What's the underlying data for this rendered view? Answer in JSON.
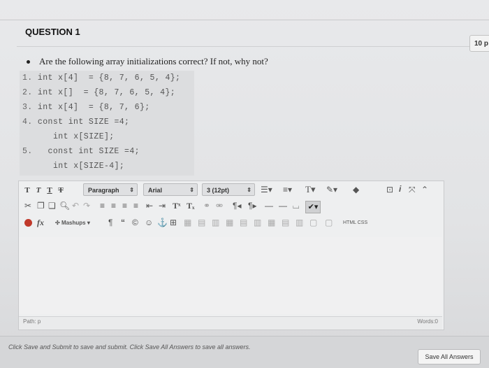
{
  "question": {
    "title": "QUESTION 1",
    "points": "10 p",
    "prompt": "Are the following array initializations correct? If not, why not?"
  },
  "code_lines": [
    {
      "num": "1.",
      "text": "int x[4]  = {8, 7, 6, 5, 4};"
    },
    {
      "num": "2.",
      "text": "int x[]  = {8, 7, 6, 5, 4};"
    },
    {
      "num": "3.",
      "text": "int x[4]  = {8, 7, 6};"
    },
    {
      "num": "4.",
      "text": "const int SIZE =4;"
    },
    {
      "num": "",
      "text": "int x[SIZE];"
    },
    {
      "num": "5.",
      "text": "const int SIZE =4;"
    },
    {
      "num": "",
      "text": "int x[SIZE-4];"
    }
  ],
  "toolbar": {
    "paragraph": "Paragraph",
    "font": "Arial",
    "size": "3 (12pt)",
    "mashups": "Mashups",
    "html_css": "HTML CSS"
  },
  "editor": {
    "path_label": "Path: p",
    "words_label": "Words:0"
  },
  "footer": {
    "note": "Click Save and Submit to save and submit. Click Save All Answers to save all answers.",
    "save_all": "Save All Answers"
  }
}
